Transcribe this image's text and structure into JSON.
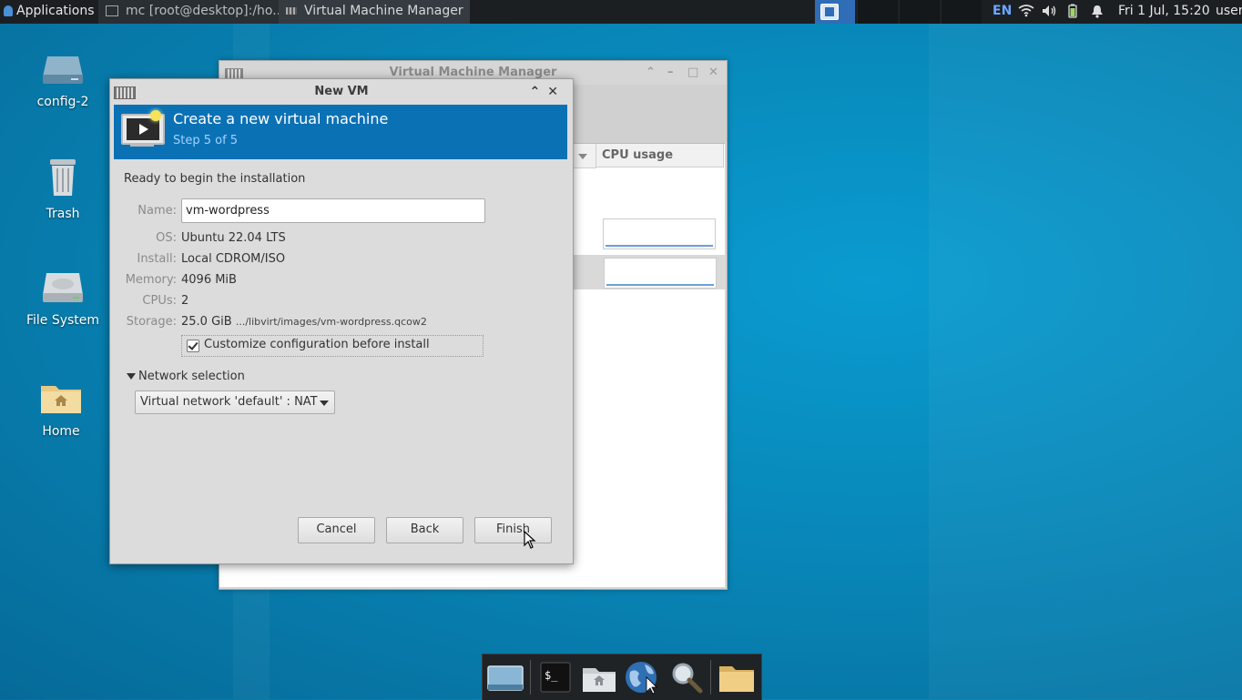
{
  "top_panel": {
    "applications_label": "Applications",
    "tasks": [
      {
        "label": "mc [root@desktop]:/ho...",
        "active": false
      },
      {
        "label": "Virtual Machine Manager",
        "active": true
      }
    ],
    "keyboard_layout": "EN",
    "clock": "Fri  1 Jul, 15:20",
    "user": "user"
  },
  "desktop_icons": [
    {
      "label": "config-2",
      "icon": "drive-icon"
    },
    {
      "label": "Trash",
      "icon": "trash-icon"
    },
    {
      "label": "File System",
      "icon": "harddisk-icon"
    },
    {
      "label": "Home",
      "icon": "home-folder-icon"
    }
  ],
  "vmm_window": {
    "title": "Virtual Machine Manager",
    "column_cpu": "CPU usage"
  },
  "dialog": {
    "title": "New VM",
    "banner_title": "Create a new virtual machine",
    "banner_step": "Step 5 of 5",
    "ready_text": "Ready to begin the installation",
    "fields": {
      "name_label": "Name:",
      "name_value": "vm-wordpress",
      "os_label": "OS:",
      "os_value": "Ubuntu 22.04 LTS",
      "install_label": "Install:",
      "install_value": "Local CDROM/ISO",
      "memory_label": "Memory:",
      "memory_value": "4096 MiB",
      "cpus_label": "CPUs:",
      "cpus_value": "2",
      "storage_label": "Storage:",
      "storage_size": "25.0 GiB",
      "storage_path": ".../libvirt/images/vm-wordpress.qcow2"
    },
    "customize_label": "Customize configuration before install",
    "customize_checked": true,
    "network_section_label": "Network selection",
    "network_value": "Virtual network 'default' : NAT",
    "buttons": {
      "cancel": "Cancel",
      "back": "Back",
      "finish": "Finish"
    }
  },
  "colors": {
    "banner": "#0b71b5",
    "desktop": "#0887b8",
    "panel": "#1b1f22"
  }
}
